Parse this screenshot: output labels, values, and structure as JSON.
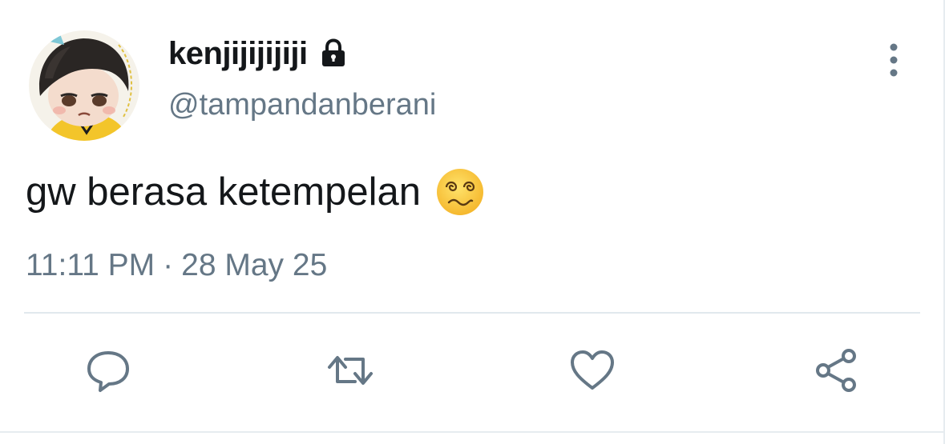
{
  "user": {
    "display_name": "kenjijijijiji",
    "handle": "@tampandanberani",
    "protected_icon": "lock-icon",
    "avatar_icon": "avatar"
  },
  "tweet": {
    "text": "gw berasa ketempelan",
    "emoji_icon": "dizzy-face-icon",
    "time": "11:11 PM",
    "separator": "·",
    "date": "28 May 25"
  },
  "actions": {
    "reply": "reply-icon",
    "retweet": "retweet-icon",
    "like": "like-icon",
    "share": "share-icon"
  },
  "menu": {
    "more": "more-vertical-icon"
  },
  "colors": {
    "primary_text": "#14171a",
    "secondary_text": "#657786",
    "icon": "#657786",
    "divider": "#e1e8ed",
    "background": "#ffffff"
  }
}
